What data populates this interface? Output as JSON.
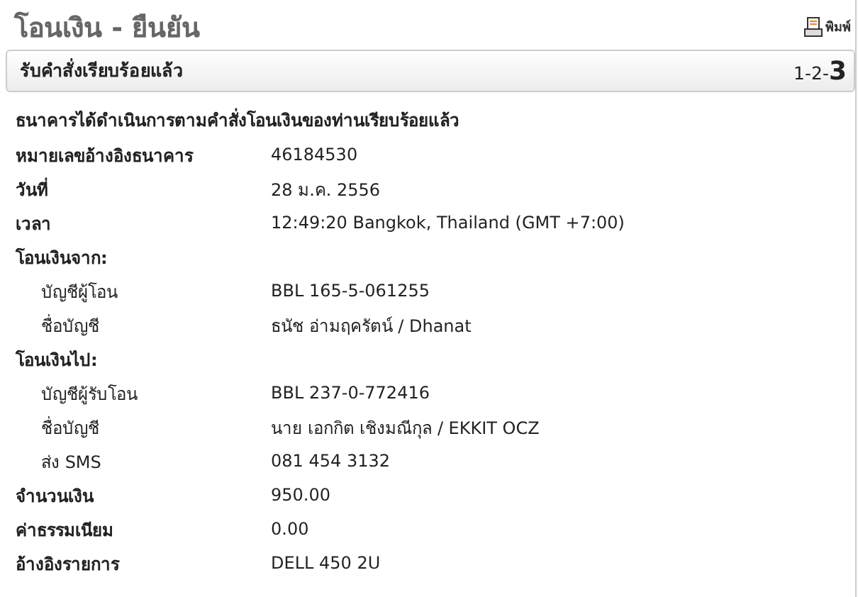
{
  "page": {
    "title": "โอนเงิน - ยืนยัน",
    "print_label": "พิมพ์"
  },
  "panel": {
    "heading": "รับคำสั่งเรียบร้อยแล้ว",
    "steps": [
      {
        "label": "1",
        "selected": false
      },
      {
        "label": "2",
        "selected": false
      },
      {
        "label": "3",
        "selected": true
      }
    ],
    "separator": "-"
  },
  "message": "ธนาคารได้ดำเนินการตามคำสั่งโอนเงินของท่านเรียบร้อยแล้ว",
  "rows": [
    {
      "kind": "field",
      "label": "หมายเลขอ้างอิงธนาคาร",
      "value": "46184530"
    },
    {
      "kind": "field",
      "label": "วันที่",
      "value": "28 ม.ค. 2556"
    },
    {
      "kind": "field",
      "label": "เวลา",
      "value": "12:49:20 Bangkok, Thailand (GMT +7:00)"
    },
    {
      "kind": "section",
      "label": "โอนเงินจาก:"
    },
    {
      "kind": "sub",
      "label": "บัญชีผู้โอน",
      "value": "BBL 165-5-061255"
    },
    {
      "kind": "sub",
      "label": "ชื่อบัญชี",
      "value": "ธนัช อ่ามฤครัตน์ / Dhanat"
    },
    {
      "kind": "section",
      "label": "โอนเงินไป:"
    },
    {
      "kind": "sub",
      "label": "บัญชีผู้รับโอน",
      "value": "BBL 237-0-772416"
    },
    {
      "kind": "sub",
      "label": "ชื่อบัญชี",
      "value": "นาย เอกกิต เชิงมณีกุล / EKKIT OCZ"
    },
    {
      "kind": "sub",
      "label": "ส่ง SMS",
      "value": "081 454 3132"
    },
    {
      "kind": "field",
      "label": "จำนวนเงิน",
      "value": "950.00"
    },
    {
      "kind": "field",
      "label": "ค่าธรรมเนียม",
      "value": "0.00"
    },
    {
      "kind": "field",
      "label": "อ้างอิงรายการ",
      "value": "DELL 450 2U"
    }
  ]
}
